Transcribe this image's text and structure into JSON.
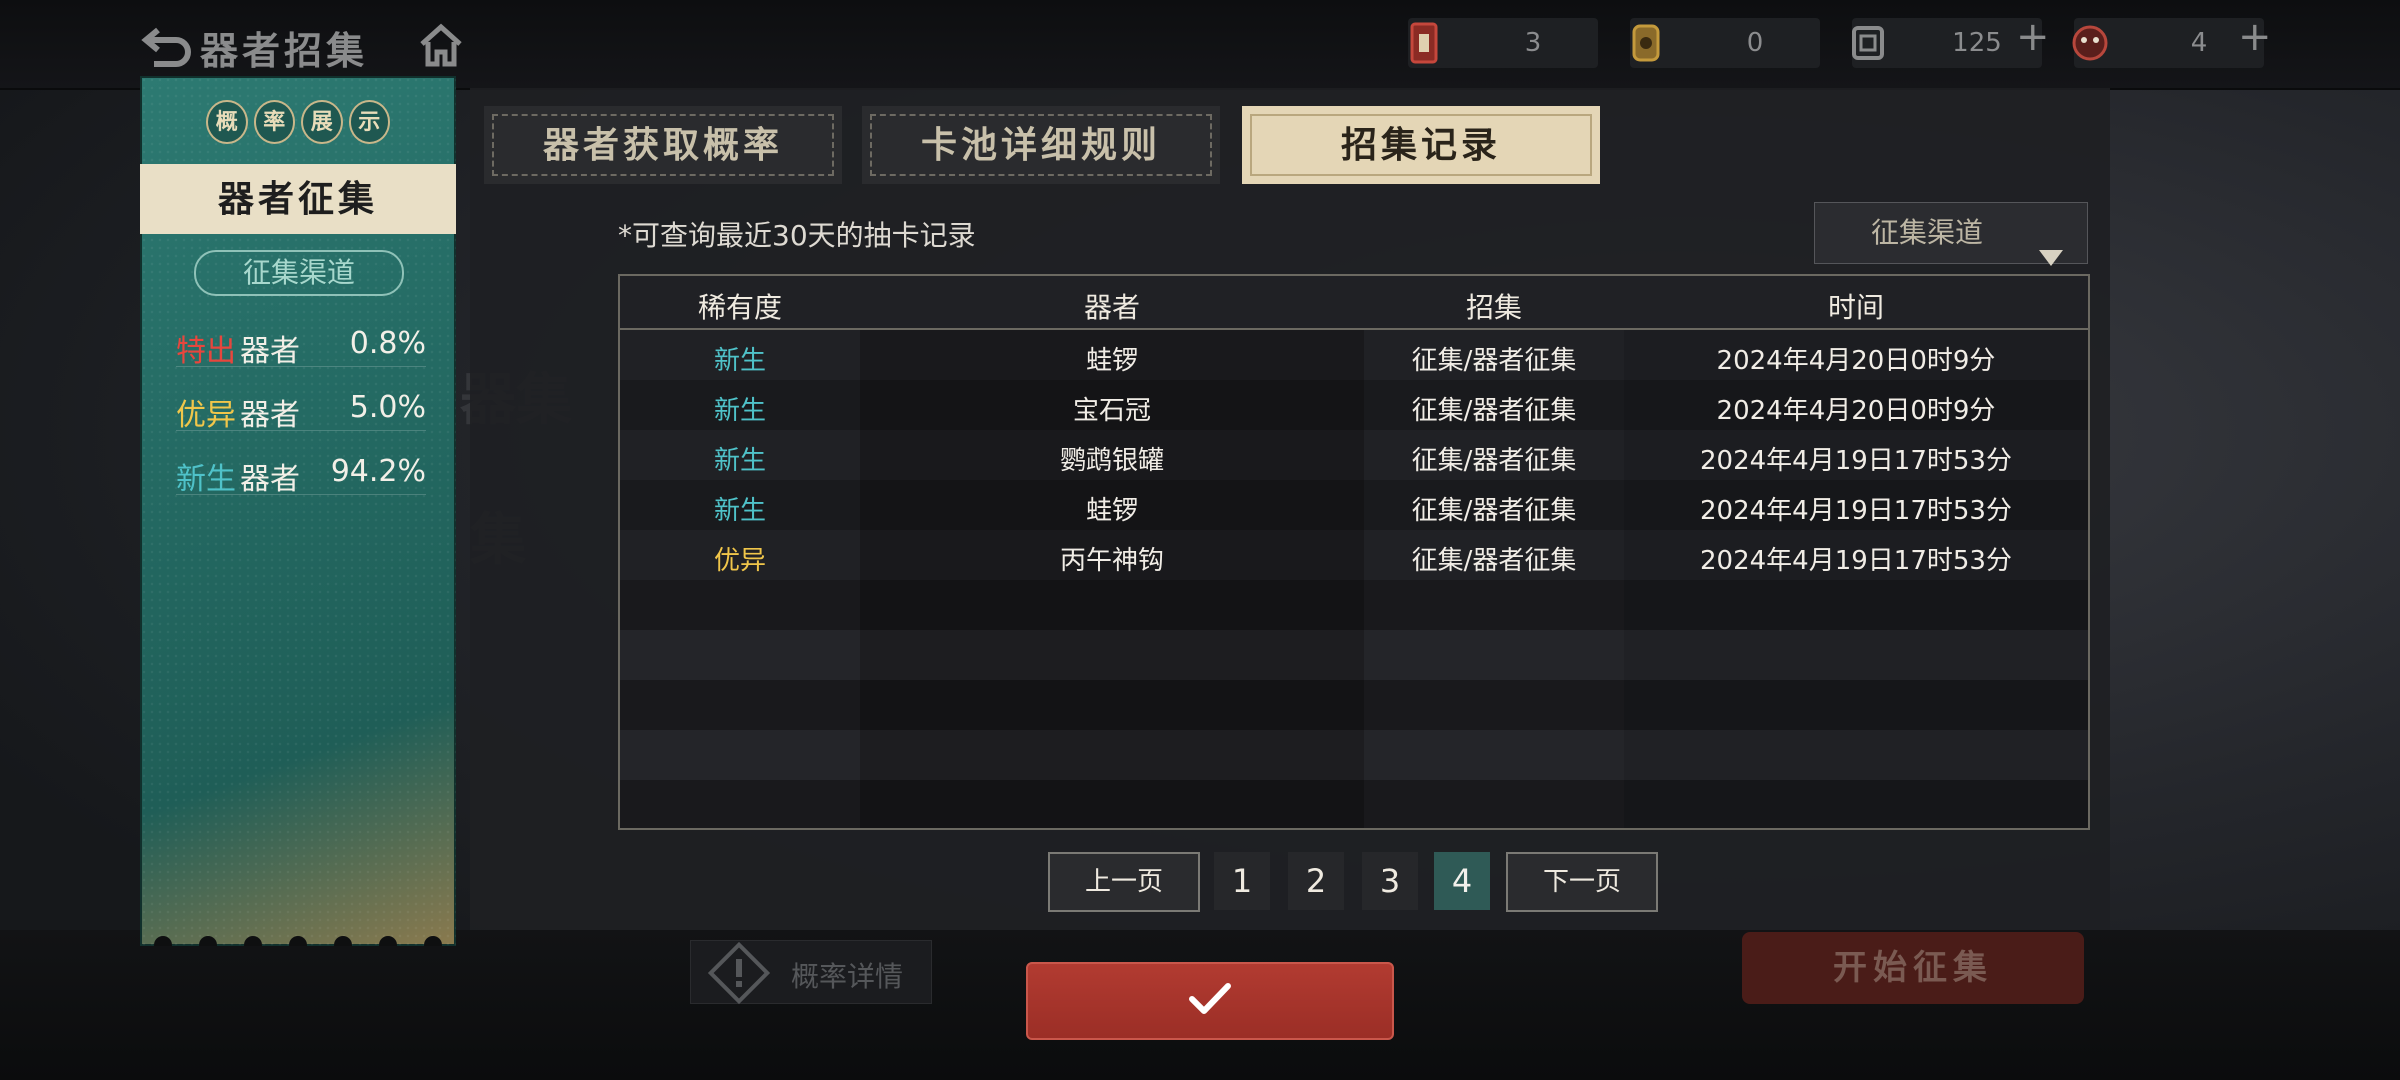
{
  "header": {
    "title": "器者招集",
    "resources": [
      {
        "icon": "red-ticket-icon",
        "value": "3"
      },
      {
        "icon": "gold-lantern-icon",
        "value": "0"
      },
      {
        "icon": "scroll-token-icon",
        "value": "125"
      },
      {
        "icon": "mask-token-icon",
        "value": "4"
      }
    ],
    "plus": "+"
  },
  "left_panel": {
    "prob_chars": [
      "概",
      "率",
      "展",
      "示"
    ],
    "pool_name": "器者征集",
    "channel": "征集渠道",
    "rates": [
      {
        "tier": "特出",
        "kind": "器者",
        "pct": "0.8%",
        "color": "#e8463d"
      },
      {
        "tier": "优异",
        "kind": "器者",
        "pct": "5.0%",
        "color": "#f0c64a"
      },
      {
        "tier": "新生",
        "kind": "器者",
        "pct": "94.2%",
        "color": "#4fc2c9"
      }
    ]
  },
  "tabs": [
    {
      "label": "器者获取概率"
    },
    {
      "label": "卡池详细规则"
    },
    {
      "label": "招集记录"
    }
  ],
  "note": "*可查询最近30天的抽卡记录",
  "filter": {
    "label": "征集渠道"
  },
  "table": {
    "headers": [
      "稀有度",
      "器者",
      "招集",
      "时间"
    ],
    "rows": [
      {
        "rarity": "新生",
        "name": "蛙锣",
        "source": "征集/器者征集",
        "time": "2024年4月20日0时9分",
        "color": "#4fc2c9"
      },
      {
        "rarity": "新生",
        "name": "宝石冠",
        "source": "征集/器者征集",
        "time": "2024年4月20日0时9分",
        "color": "#4fc2c9"
      },
      {
        "rarity": "新生",
        "name": "鹦鹉银罐",
        "source": "征集/器者征集",
        "time": "2024年4月19日17时53分",
        "color": "#4fc2c9"
      },
      {
        "rarity": "新生",
        "name": "蛙锣",
        "source": "征集/器者征集",
        "time": "2024年4月19日17时53分",
        "color": "#4fc2c9"
      },
      {
        "rarity": "优异",
        "name": "丙午神钩",
        "source": "征集/器者征集",
        "time": "2024年4月19日17时53分",
        "color": "#f0c64a"
      }
    ]
  },
  "pager": {
    "prev": "上一页",
    "next": "下一页",
    "pages": [
      "1",
      "2",
      "3",
      "4"
    ],
    "current": "4"
  },
  "bottom": {
    "prob_detail": "概率详情",
    "start": "开始征集"
  },
  "background_text": [
    "器集",
    "集"
  ]
}
